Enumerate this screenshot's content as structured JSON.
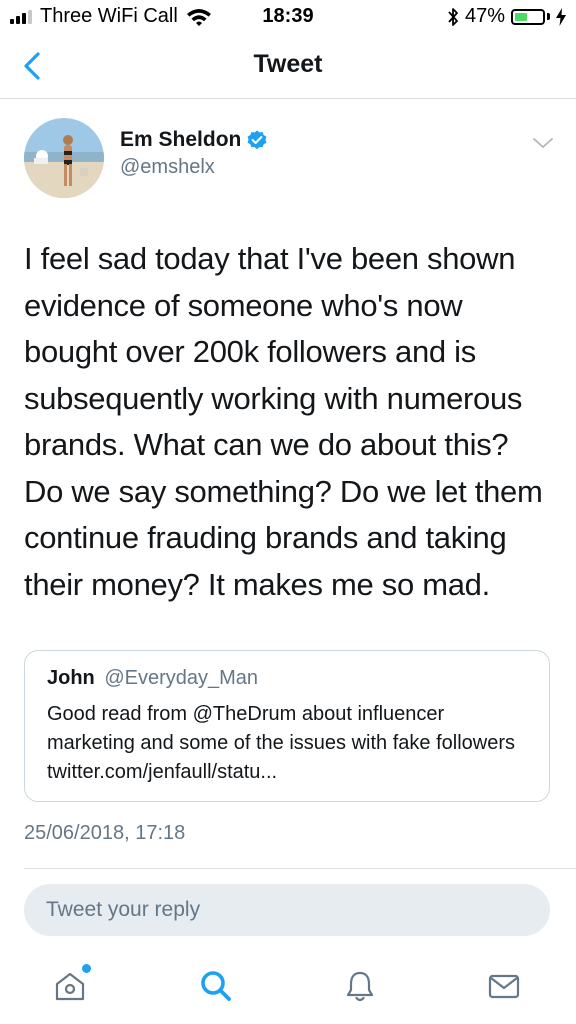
{
  "status_bar": {
    "carrier": "Three WiFi Call",
    "time": "18:39",
    "battery_level": 0.47,
    "battery_text": "47%"
  },
  "header": {
    "title": "Tweet",
    "back_icon": "chevron-left-icon"
  },
  "tweet": {
    "author_name": "Em Sheldon",
    "author_handle": "@emshelx",
    "verified": true,
    "text": "I feel sad today that I've been shown evidence of someone who's now bought over 200k followers and is subsequently working with numerous brands. What can we do about this? Do we say something? Do we let them continue frauding brands and taking their money? It makes me so mad.",
    "timestamp": "25/06/2018, 17:18"
  },
  "quoted_tweet": {
    "author_name": "John",
    "author_handle": "@Everyday_Man",
    "text": "Good read from @TheDrum about influencer marketing and some of the issues with fake followers twitter.com/jenfaull/statu..."
  },
  "reply": {
    "placeholder": "Tweet your reply"
  },
  "tab_bar": {
    "items": [
      "home-icon",
      "search-icon",
      "notifications-icon",
      "messages-icon"
    ]
  },
  "colors": {
    "accent": "#1da1f2",
    "text": "#14171a",
    "muted": "#657786",
    "reply_bg": "#e6ecf0",
    "battery": "#4cd964"
  }
}
